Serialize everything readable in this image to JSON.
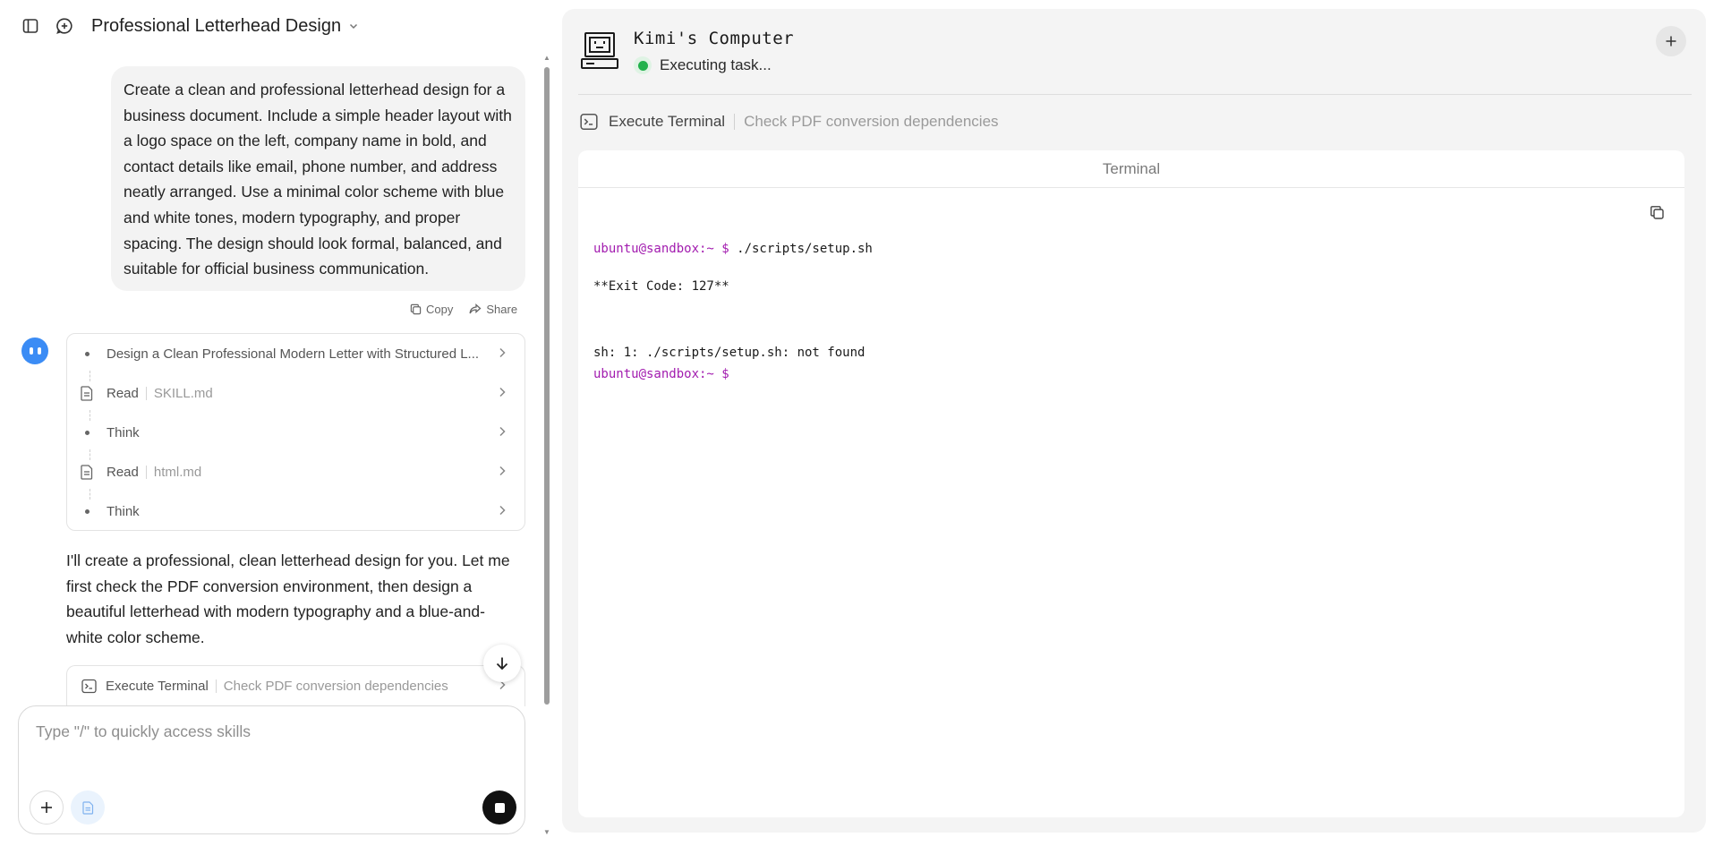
{
  "header": {
    "title": "Professional Letterhead Design"
  },
  "user_message": {
    "text": "Create a clean and professional letterhead design for a business document. Include a simple header layout with a logo space on the left, company name in bold, and contact details like email, phone number, and address neatly arranged. Use a minimal color scheme with blue and white tones, modern typography, and proper spacing. The design should look formal, balanced, and suitable for official business communication."
  },
  "message_actions": {
    "copy": "Copy",
    "share": "Share"
  },
  "steps": [
    {
      "label": "Design a Clean Professional Modern Letter with Structured L...",
      "sub": "",
      "icon": "bullet"
    },
    {
      "label": "Read",
      "sub": "SKILL.md",
      "icon": "document-icon"
    },
    {
      "label": "Think",
      "sub": "",
      "icon": "bullet"
    },
    {
      "label": "Read",
      "sub": "html.md",
      "icon": "document-icon"
    },
    {
      "label": "Think",
      "sub": "",
      "icon": "bullet"
    }
  ],
  "assistant_message": {
    "text": "I'll create a professional, clean letterhead design for you. Let me first check the PDF conversion environment, then design a beautiful letterhead with modern typography and a blue-and-white color scheme."
  },
  "tool_card": {
    "label": "Execute Terminal",
    "sub": "Check PDF conversion dependencies"
  },
  "composer": {
    "placeholder": "Type \"/\" to quickly access skills"
  },
  "computer": {
    "title": "Kimi's Computer",
    "status": "Executing task...",
    "status_color": "#22b14c",
    "tool_label": "Execute Terminal",
    "tool_sub": "Check PDF conversion dependencies"
  },
  "terminal": {
    "title": "Terminal",
    "prompt": "ubuntu@sandbox:~ $",
    "lines": {
      "cmd": " ./scripts/setup.sh",
      "exit": "**Exit Code: 127**",
      "error": "sh: 1: ./scripts/setup.sh: not found"
    },
    "prompt_color": "#a21caf"
  }
}
